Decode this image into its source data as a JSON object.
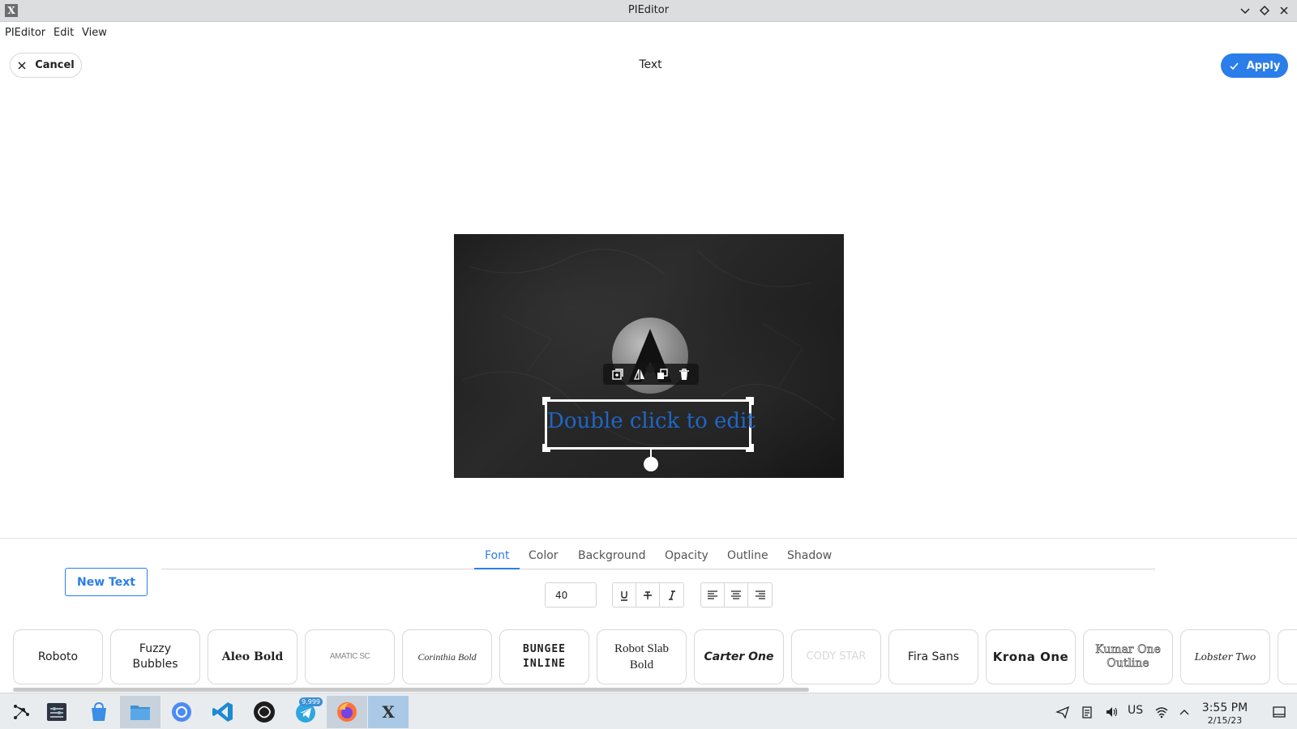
{
  "window": {
    "title": "PIEditor"
  },
  "menubar": {
    "items": [
      "PIEditor",
      "Edit",
      "View"
    ]
  },
  "header": {
    "cancel_label": "Cancel",
    "title": "Text",
    "apply_label": "Apply"
  },
  "canvas": {
    "text_content": "Double click to edit",
    "text_color": "#1f66c6",
    "floating_toolbar": [
      "duplicate-icon",
      "flip-icon",
      "bring-front-icon",
      "delete-icon"
    ]
  },
  "panel": {
    "tabs": [
      "Font",
      "Color",
      "Background",
      "Opacity",
      "Outline",
      "Shadow"
    ],
    "active_tab": "Font",
    "new_text_label": "New Text",
    "font_size": "40",
    "style_buttons": [
      "underline-icon",
      "strikethrough-icon",
      "italic-icon"
    ],
    "align_buttons": [
      "align-left-icon",
      "align-center-icon",
      "align-right-icon"
    ],
    "fonts": [
      "Roboto",
      "Fuzzy Bubbles",
      "Aleo Bold",
      "AMATIC SC",
      "Corinthia Bold",
      "BUNGEE INLINE",
      "Robot Slab Bold",
      "Carter One",
      "CODY STAR",
      "Fira Sans",
      "Krona One",
      "Kumar One Outline",
      "Lobster Two"
    ]
  },
  "taskbar": {
    "telegram_badge": "9,999",
    "keyboard_layout": "US",
    "time": "3:55 PM",
    "date": "2/15/23"
  },
  "colors": {
    "accent": "#2b7de9",
    "taskbar_bg": "#e9ecef"
  }
}
